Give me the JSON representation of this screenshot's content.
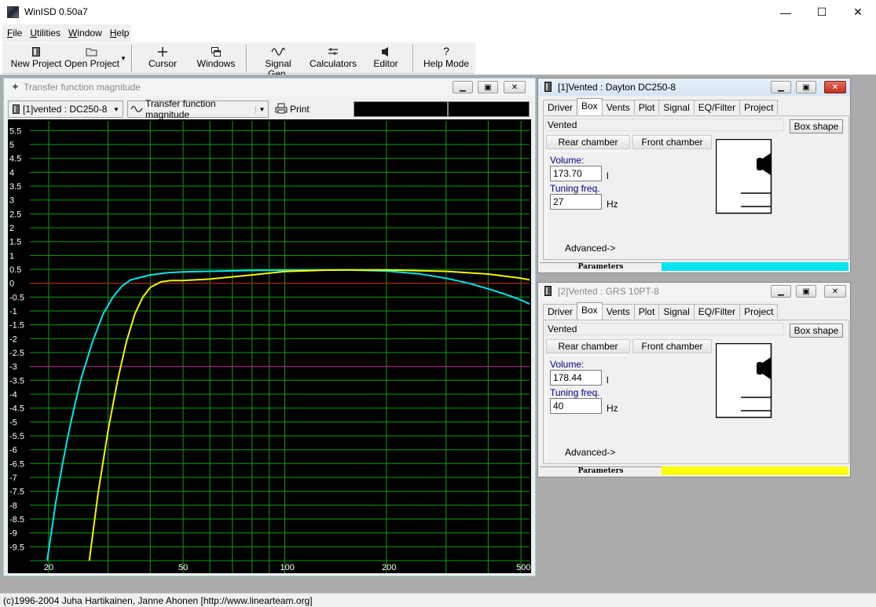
{
  "app": {
    "title": "WinISD 0.50a7"
  },
  "window_controls": {
    "minimize": "—",
    "maximize": "☐",
    "close": "✕"
  },
  "menu": [
    {
      "label": "File",
      "key": "F"
    },
    {
      "label": "Utilities",
      "key": "U"
    },
    {
      "label": "Window",
      "key": "W"
    },
    {
      "label": "Help",
      "key": "H"
    }
  ],
  "toolbar": {
    "new_project": "New Project",
    "open_project": "Open Project",
    "cursor": "Cursor",
    "windows": "Windows",
    "signal_gen": "Signal Gen.",
    "calculators": "Calculators",
    "editor": "Editor",
    "help_mode": "Help Mode"
  },
  "graph_window": {
    "title": "Transfer function magnitude",
    "project_select": "[1]vented : DC250-8",
    "graph_type_select": "Transfer function magnitude",
    "print_label": "Print"
  },
  "chart_data": {
    "type": "line",
    "x_scale": "log",
    "xlim": [
      17.6,
      530
    ],
    "ylim": [
      -10,
      5.85
    ],
    "y_ticks": [
      "5.5",
      "5",
      "4.5",
      "4",
      "3.5",
      "3",
      "2.5",
      "2",
      "1.5",
      "1",
      "0.5",
      "0",
      "-0.5",
      "-1",
      "-1.5",
      "-2",
      "-2.5",
      "-3",
      "-3.5",
      "-4",
      "-4.5",
      "-5",
      "-5.5",
      "-6",
      "-6.5",
      "-7",
      "-7.5",
      "-8",
      "-8.5",
      "-9",
      "-9.5"
    ],
    "x_ticks": [
      "20",
      "50",
      "100",
      "200",
      "500"
    ],
    "reference_lines": [
      {
        "y": 0,
        "color": "#d01010"
      },
      {
        "y": -3,
        "color": "#c01880"
      }
    ],
    "grid": true,
    "colors": {
      "background": "#000000",
      "grid": "#0f9d0f"
    },
    "series": [
      {
        "color": "#00e5ee",
        "x": [
          19.8,
          21,
          22,
          23,
          24,
          25,
          27,
          29,
          31,
          33,
          35,
          40,
          45,
          50,
          60,
          80,
          100,
          150,
          200,
          250,
          300,
          350,
          400,
          450,
          500,
          530
        ],
        "y": [
          -10,
          -7.9,
          -6.5,
          -5.3,
          -4.3,
          -3.4,
          -2.1,
          -1.1,
          -0.5,
          -0.1,
          0.12,
          0.3,
          0.38,
          0.41,
          0.43,
          0.46,
          0.47,
          0.48,
          0.44,
          0.34,
          0.18,
          0.0,
          -0.2,
          -0.4,
          -0.6,
          -0.75
        ]
      },
      {
        "color": "#f5f500",
        "x": [
          26.4,
          28,
          30,
          32,
          34,
          36,
          38,
          40,
          43,
          46,
          50,
          60,
          80,
          100,
          130,
          150,
          200,
          300,
          400,
          500,
          530
        ],
        "y": [
          -10,
          -7.6,
          -5.3,
          -3.5,
          -2.1,
          -1.1,
          -0.5,
          -0.15,
          0.05,
          0.1,
          0.1,
          0.15,
          0.3,
          0.42,
          0.47,
          0.48,
          0.48,
          0.43,
          0.33,
          0.18,
          0.12
        ]
      }
    ]
  },
  "box_windows": [
    {
      "title": "[1]Vented : Dayton  DC250-8",
      "tabs": [
        "Driver",
        "Box",
        "Vents",
        "Plot",
        "Signal",
        "EQ/Filter",
        "Project"
      ],
      "selected_tab": "Box",
      "box_type": "Vented",
      "box_shape_label": "Box shape",
      "rear_chamber_label": "Rear chamber",
      "front_chamber_label": "Front chamber",
      "volume_label": "Volume:",
      "volume_value": "173.70",
      "volume_unit": "l",
      "tuning_label": "Tuning freq.",
      "tuning_value": "27",
      "tuning_unit": "Hz",
      "advanced_label": "Advanced->",
      "parameters_label": "Parameters",
      "series_color": "#00e5ee"
    },
    {
      "title": "[2]Vented : GRS 10PT-8",
      "tabs": [
        "Driver",
        "Box",
        "Vents",
        "Plot",
        "Signal",
        "EQ/Filter",
        "Project"
      ],
      "selected_tab": "Box",
      "box_type": "Vented",
      "box_shape_label": "Box shape",
      "rear_chamber_label": "Rear chamber",
      "front_chamber_label": "Front chamber",
      "volume_label": "Volume:",
      "volume_value": "178.44",
      "volume_unit": "l",
      "tuning_label": "Tuning freq.",
      "tuning_value": "40",
      "tuning_unit": "Hz",
      "advanced_label": "Advanced->",
      "parameters_label": "Parameters",
      "series_color": "#ffff00"
    }
  ],
  "status": {
    "text": "(c)1996-2004 Juha Hartikainen, Janne Ahonen [http://www.linearteam.org]"
  }
}
